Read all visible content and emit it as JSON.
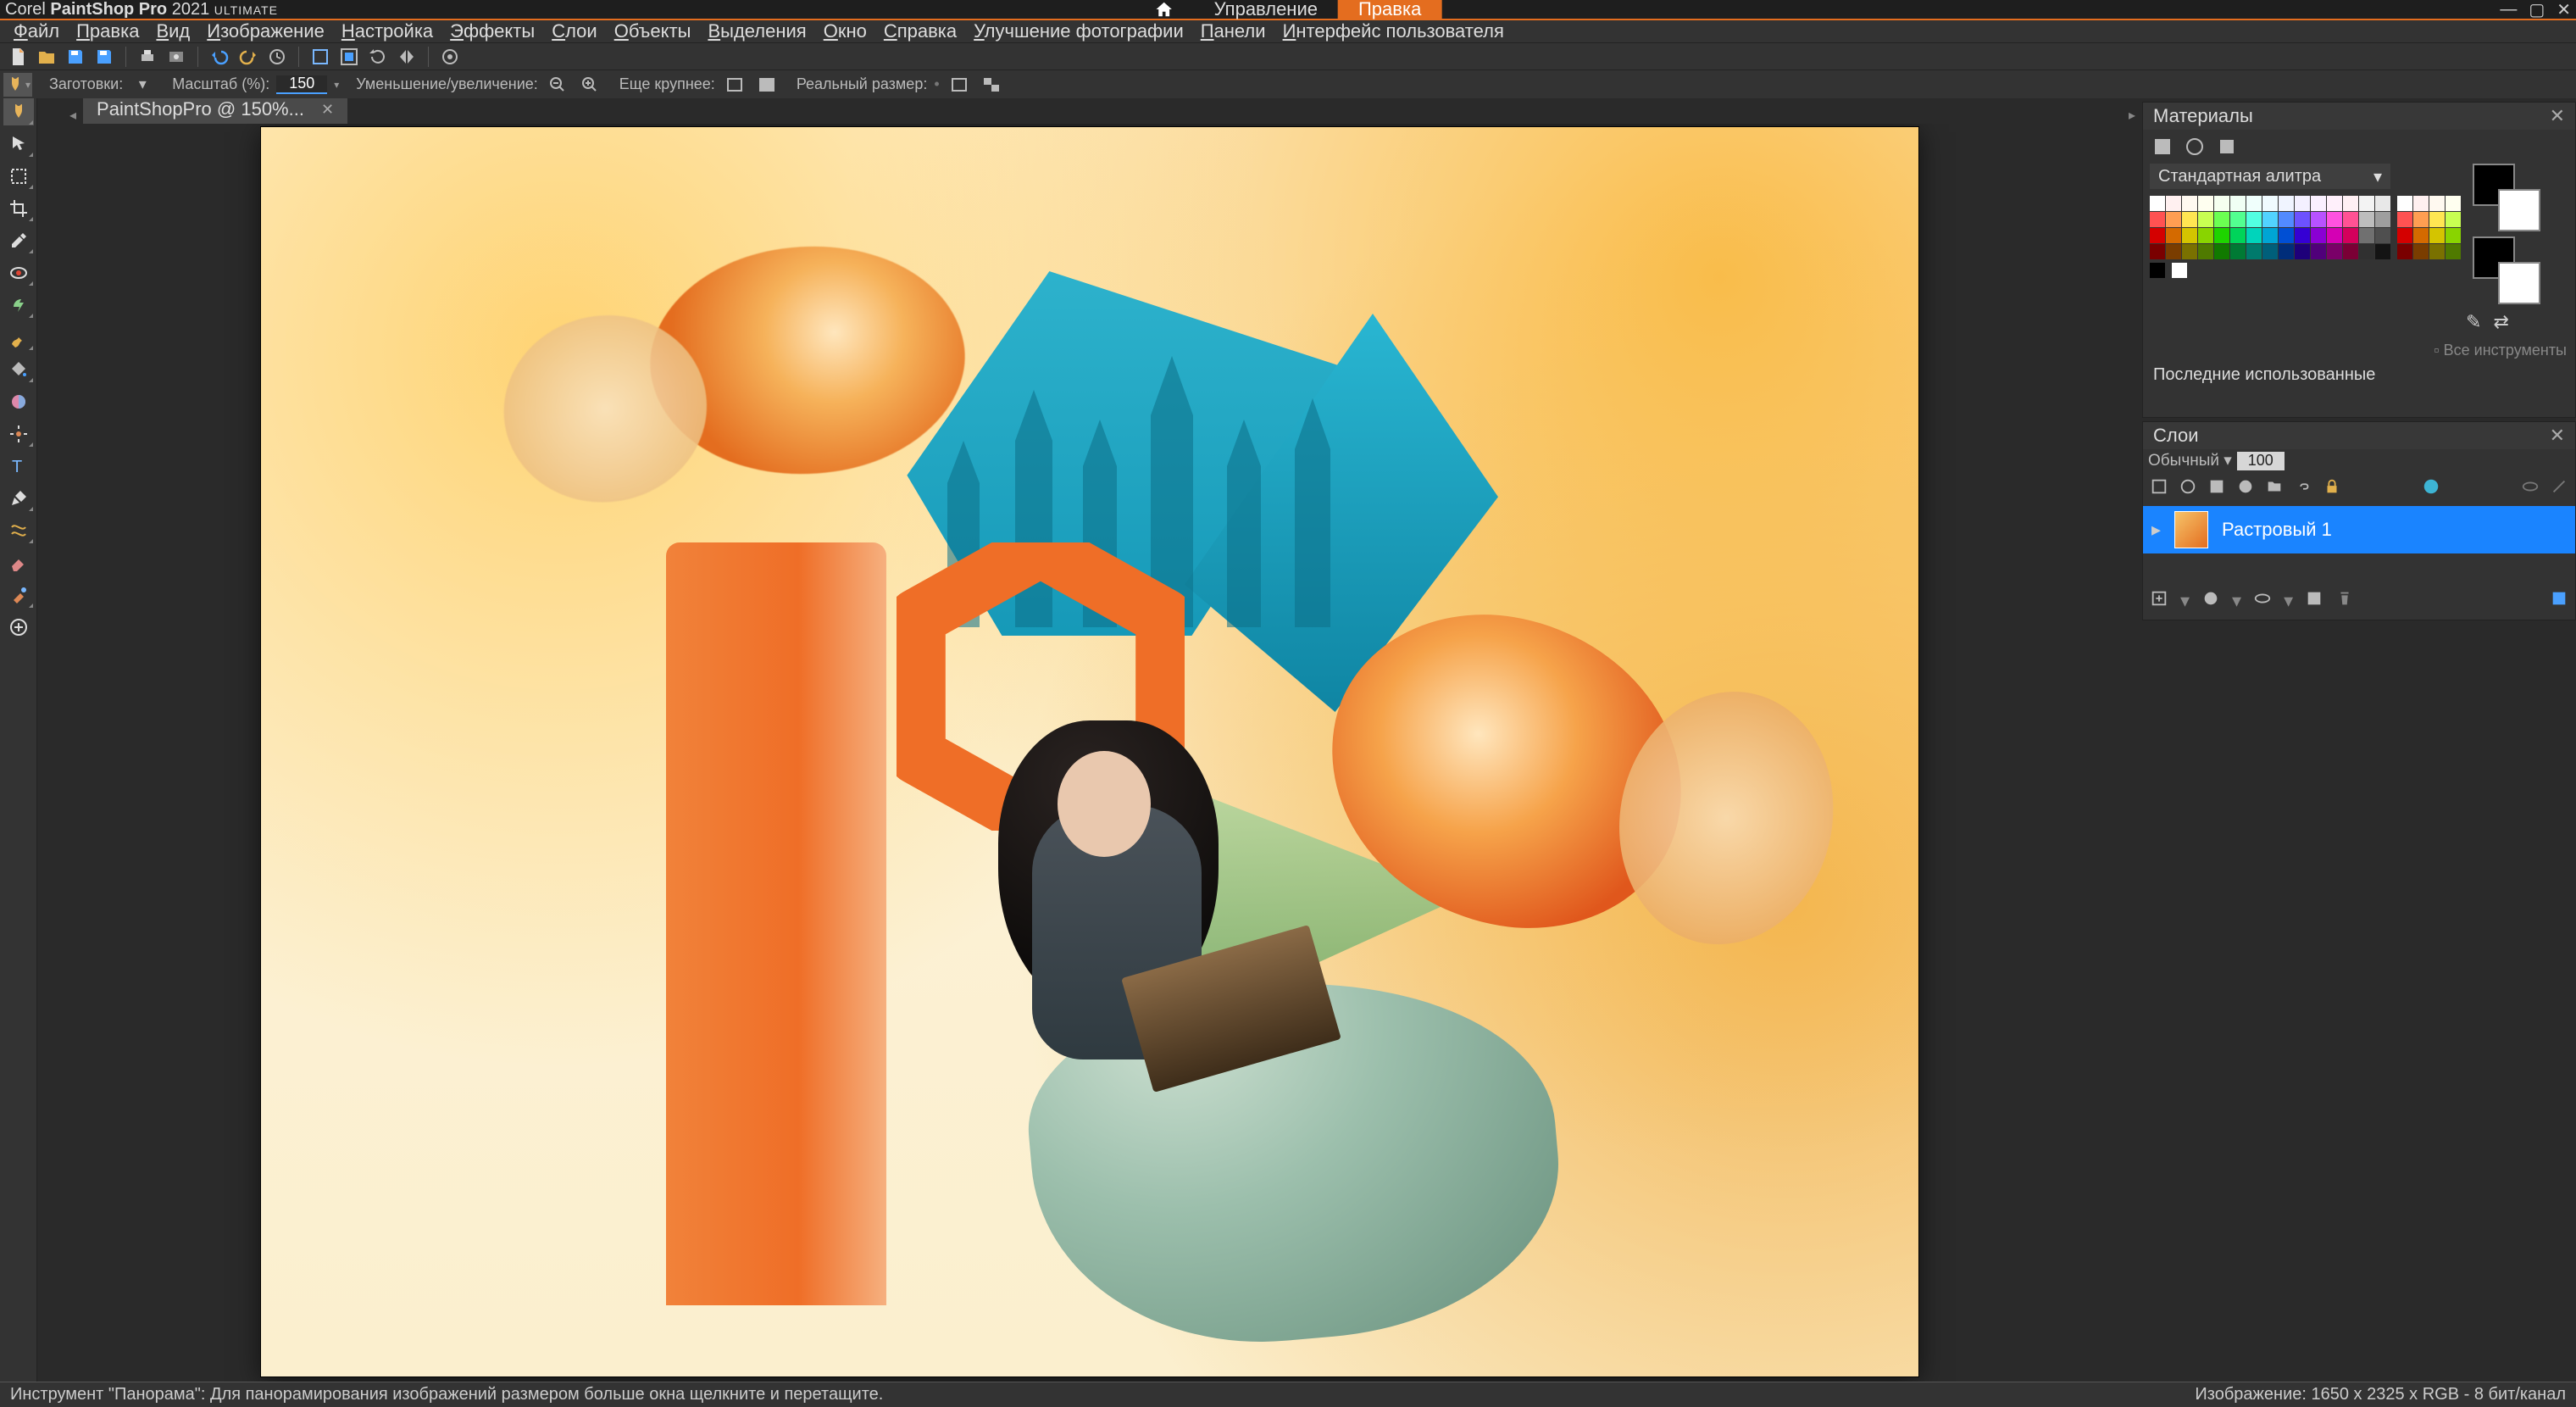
{
  "app": {
    "brand_prefix": "Corel",
    "brand_name": "PaintShop Pro",
    "brand_year": "2021",
    "brand_edition": "ULTIMATE"
  },
  "workspace": {
    "manage": "Управление",
    "edit": "Правка"
  },
  "menus": [
    "Файл",
    "Правка",
    "Вид",
    "Изображение",
    "Настройка",
    "Эффекты",
    "Слои",
    "Объекты",
    "Выделения",
    "Окно",
    "Справка",
    "Улучшение фотографии",
    "Панели",
    "Интерфейс пользователя"
  ],
  "options": {
    "presets": "Заготовки:",
    "zoom_label": "Масштаб (%):",
    "zoom_value": "150",
    "zoom_inout": "Уменьшение/увеличение:",
    "larger": "Еще крупнее:",
    "actual": "Реальный размер:"
  },
  "doc_tab": "PaintShopPro  @  150%...",
  "tools": [
    "pan",
    "pointer",
    "marquee",
    "crop",
    "eyedropper",
    "redeye",
    "clone",
    "brush",
    "fill",
    "colorchange",
    "retouch",
    "text",
    "pen",
    "warp",
    "eraser",
    "colorrep",
    "add"
  ],
  "panels": {
    "materials": {
      "title": "Материалы",
      "palette_dd": "Стандартная алитра",
      "all_tools": "Все инструменты",
      "recent": "Последние использованные",
      "fg": "#000000",
      "bg": "#ffffff"
    },
    "layers": {
      "title": "Слои",
      "blend": "Обычный",
      "opacity": "100",
      "layer1": "Растровый 1"
    }
  },
  "status": {
    "left": "Инструмент \"Панорама\": Для панорамирования изображений размером больше окна щелкните и перетащите.",
    "right": "Изображение:  1650 x 2325 x RGB - 8 бит/канал"
  },
  "colors": {
    "accent": "#e46d1f",
    "selection": "#1a84ff"
  },
  "swatches_rows": [
    [
      "#ffffff",
      "#fff0f0",
      "#fff9f0",
      "#fffff0",
      "#f5fff0",
      "#f0fff4",
      "#f0fffc",
      "#f0fbff",
      "#f0f4ff",
      "#f4f0ff",
      "#faf0ff",
      "#fff0fb",
      "#fff0f4",
      "#f3f3f3",
      "#e8e8e8"
    ],
    [
      "#ff5252",
      "#ff9e52",
      "#ffe652",
      "#c8ff52",
      "#6bff52",
      "#52ff90",
      "#52ffe2",
      "#52d3ff",
      "#528aff",
      "#6d52ff",
      "#b852ff",
      "#ff52e0",
      "#ff5294",
      "#bdbdbd",
      "#9e9e9e"
    ],
    [
      "#d40000",
      "#d46a00",
      "#d4c400",
      "#89d400",
      "#1ed400",
      "#00d45a",
      "#00d4bb",
      "#00a5d4",
      "#004fd4",
      "#3500d4",
      "#8a00d4",
      "#d400b4",
      "#d4005c",
      "#707070",
      "#4f4f4f"
    ],
    [
      "#7a0000",
      "#7a3d00",
      "#7a7100",
      "#4f7a00",
      "#117a00",
      "#007a34",
      "#007a6c",
      "#005f7a",
      "#002d7a",
      "#1e007a",
      "#50007a",
      "#7a0068",
      "#7a0035",
      "#303030",
      "#141414"
    ]
  ]
}
